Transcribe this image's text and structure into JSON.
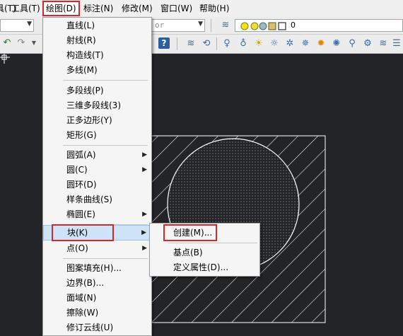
{
  "menubar": {
    "items": [
      {
        "label": "具(T)",
        "active": false
      },
      {
        "label": "工具(T)",
        "active": false
      },
      {
        "label": "绘图(D)",
        "active": true
      },
      {
        "label": "标注(N)",
        "active": false
      },
      {
        "label": "修改(M)",
        "active": false
      },
      {
        "label": "窗口(W)",
        "active": false
      },
      {
        "label": "帮助(H)",
        "active": false
      }
    ]
  },
  "toolbar": {
    "style_combo_text": "or",
    "layer_combo_value": "0"
  },
  "draw_menu": {
    "items": [
      {
        "label": "直线(L)",
        "submenu": false
      },
      {
        "label": "射线(R)",
        "submenu": false
      },
      {
        "label": "构造线(T)",
        "submenu": false
      },
      {
        "label": "多线(M)",
        "submenu": false
      },
      {
        "label": "多段线(P)",
        "submenu": false
      },
      {
        "label": "三维多段线(3)",
        "submenu": false
      },
      {
        "label": "正多边形(Y)",
        "submenu": false
      },
      {
        "label": "矩形(G)",
        "submenu": false
      },
      {
        "label": "圆弧(A)",
        "submenu": true
      },
      {
        "label": "圆(C)",
        "submenu": true
      },
      {
        "label": "圆环(D)",
        "submenu": false
      },
      {
        "label": "样条曲线(S)",
        "submenu": false
      },
      {
        "label": "椭圆(E)",
        "submenu": true
      },
      {
        "label": "块(K)",
        "submenu": true
      },
      {
        "label": "点(O)",
        "submenu": true
      },
      {
        "label": "图案填充(H)...",
        "submenu": false
      },
      {
        "label": "边界(B)...",
        "submenu": false
      },
      {
        "label": "面域(N)",
        "submenu": false
      },
      {
        "label": "擦除(W)",
        "submenu": false
      },
      {
        "label": "修订云线(U)",
        "submenu": false
      }
    ]
  },
  "block_submenu": {
    "items": [
      {
        "label": "创建(M)..."
      },
      {
        "label": "基点(B)"
      },
      {
        "label": "定义属性(D)..."
      }
    ]
  },
  "colors": {
    "highlight_box": "#d6262d",
    "menu_highlight": "#cfe3f7",
    "canvas_bg": "#222427"
  }
}
